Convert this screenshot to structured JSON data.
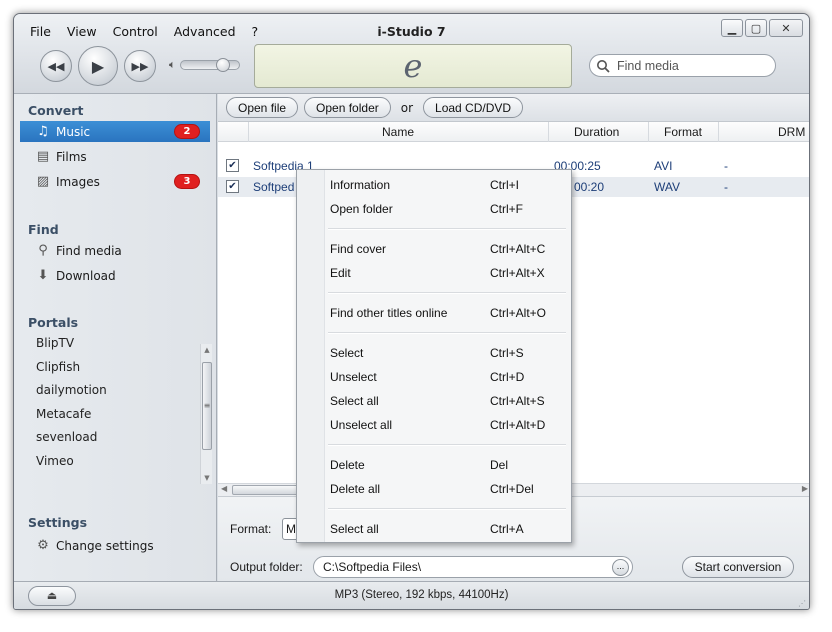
{
  "window": {
    "title": "i-Studio 7",
    "menu": [
      "File",
      "View",
      "Control",
      "Advanced",
      "?"
    ],
    "controls": [
      "minimize",
      "maximize",
      "close"
    ]
  },
  "player": {
    "display_logo": "e",
    "volume_level": 0.8
  },
  "search": {
    "placeholder": "Find media"
  },
  "sidebar": {
    "convert": {
      "heading": "Convert",
      "items": [
        {
          "label": "Music",
          "icon": "music-note-icon",
          "badge": "2",
          "selected": true
        },
        {
          "label": "Films",
          "icon": "film-icon",
          "badge": ""
        },
        {
          "label": "Images",
          "icon": "image-icon",
          "badge": "3"
        }
      ]
    },
    "find": {
      "heading": "Find",
      "items": [
        {
          "label": "Find media",
          "icon": "search-icon"
        },
        {
          "label": "Download",
          "icon": "download-icon"
        }
      ]
    },
    "portals": {
      "heading": "Portals",
      "items": [
        "BlipTV",
        "Clipfish",
        "dailymotion",
        "Metacafe",
        "sevenload",
        "Vimeo"
      ]
    },
    "settings": {
      "heading": "Settings",
      "items": [
        {
          "label": "Change settings",
          "icon": "gear-icon"
        }
      ]
    }
  },
  "toolbar": {
    "open_file": "Open file",
    "open_folder": "Open folder",
    "or": "or",
    "load_cd": "Load CD/DVD"
  },
  "table": {
    "columns": [
      "Name",
      "Duration",
      "Format",
      "DRM"
    ],
    "rows": [
      {
        "checked": true,
        "name": "Softpedia 1",
        "duration": "00:00:25",
        "format": "AVI",
        "drm": "-"
      },
      {
        "checked": true,
        "name": "Softped",
        "duration": "00:20",
        "format": "WAV",
        "drm": "-"
      }
    ]
  },
  "bottom": {
    "format_label": "Format:",
    "format_value": "M",
    "output_label": "Output folder:",
    "output_value": "C:\\Softpedia Files\\",
    "browse_label": "...",
    "start_label": "Start conversion"
  },
  "status": {
    "text": "MP3 (Stereo, 192 kbps, 44100Hz)"
  },
  "context_menu": {
    "groups": [
      [
        {
          "label": "Information",
          "shortcut": "Ctrl+I"
        },
        {
          "label": "Open folder",
          "shortcut": "Ctrl+F"
        }
      ],
      [
        {
          "label": "Find cover",
          "shortcut": "Ctrl+Alt+C"
        },
        {
          "label": "Edit",
          "shortcut": "Ctrl+Alt+X"
        }
      ],
      [
        {
          "label": "Find other titles online",
          "shortcut": "Ctrl+Alt+O"
        }
      ],
      [
        {
          "label": "Select",
          "shortcut": "Ctrl+S"
        },
        {
          "label": "Unselect",
          "shortcut": "Ctrl+D"
        },
        {
          "label": "Select all",
          "shortcut": "Ctrl+Alt+S"
        },
        {
          "label": "Unselect all",
          "shortcut": "Ctrl+Alt+D"
        }
      ],
      [
        {
          "label": "Delete",
          "shortcut": "Del"
        },
        {
          "label": "Delete all",
          "shortcut": "Ctrl+Del"
        }
      ],
      [
        {
          "label": "Select all",
          "shortcut": "Ctrl+A"
        }
      ]
    ]
  },
  "colors": {
    "selection": "#2a74bf",
    "badge": "#e02020",
    "link_text": "#1d3e78"
  }
}
